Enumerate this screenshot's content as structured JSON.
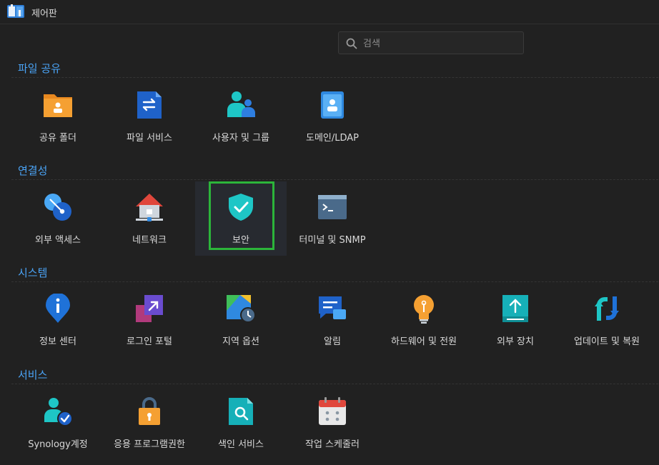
{
  "window": {
    "title": "제어판"
  },
  "search": {
    "placeholder": "검색",
    "value": ""
  },
  "sections": [
    {
      "title": "파일 공유",
      "items": [
        {
          "label": "공유 폴더",
          "icon": "shared-folder-icon"
        },
        {
          "label": "파일 서비스",
          "icon": "file-services-icon"
        },
        {
          "label": "사용자 및 그룹",
          "icon": "user-group-icon"
        },
        {
          "label": "도메인/LDAP",
          "icon": "domain-ldap-icon"
        }
      ]
    },
    {
      "title": "연결성",
      "items": [
        {
          "label": "외부 액세스",
          "icon": "external-access-icon"
        },
        {
          "label": "네트워크",
          "icon": "network-icon"
        },
        {
          "label": "보안",
          "icon": "security-shield-icon",
          "selected": true
        },
        {
          "label": "터미널 및 SNMP",
          "icon": "terminal-icon"
        }
      ]
    },
    {
      "title": "시스템",
      "items": [
        {
          "label": "정보 센터",
          "icon": "info-center-icon"
        },
        {
          "label": "로그인 포털",
          "icon": "login-portal-icon"
        },
        {
          "label": "지역 옵션",
          "icon": "regional-options-icon"
        },
        {
          "label": "알림",
          "icon": "notification-icon"
        },
        {
          "label": "하드웨어 및 전원",
          "icon": "hardware-power-icon"
        },
        {
          "label": "외부 장치",
          "icon": "external-devices-icon"
        },
        {
          "label": "업데이트 및 복원",
          "icon": "update-restore-icon"
        }
      ]
    },
    {
      "title": "서비스",
      "items": [
        {
          "label": "Synology계정",
          "icon": "synology-account-icon"
        },
        {
          "label": "응용 프로그램권한",
          "icon": "app-privileges-icon"
        },
        {
          "label": "색인 서비스",
          "icon": "indexing-service-icon"
        },
        {
          "label": "작업 스케줄러",
          "icon": "task-scheduler-icon"
        }
      ]
    }
  ],
  "colors": {
    "accent": "#4aa3f5",
    "highlight": "#2cb53a",
    "background": "#212121"
  }
}
